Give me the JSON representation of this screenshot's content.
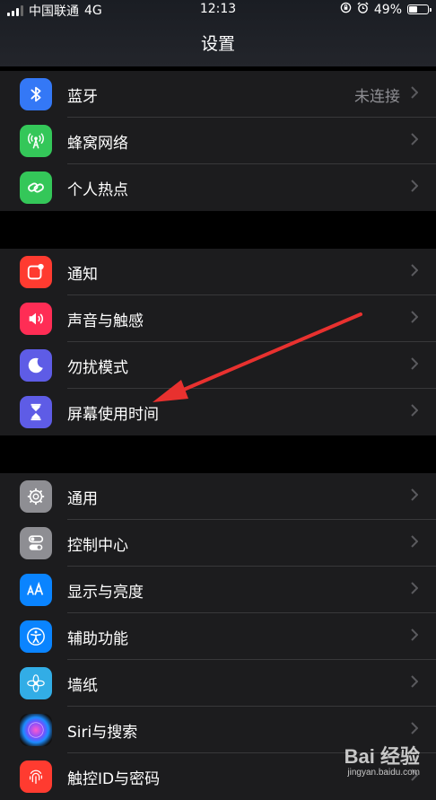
{
  "status_bar": {
    "carrier": "中国联通",
    "network": "4G",
    "time": "12:13",
    "battery": "49%",
    "battery_level": 0.49
  },
  "header": {
    "title": "设置"
  },
  "groups": [
    {
      "items": [
        {
          "label": "蓝牙",
          "value": "未连接",
          "icon": "bluetooth-icon",
          "color": "#3478f6"
        },
        {
          "label": "蜂窝网络",
          "icon": "cellular-icon",
          "color": "#34c759"
        },
        {
          "label": "个人热点",
          "icon": "hotspot-icon",
          "color": "#34c759"
        }
      ]
    },
    {
      "items": [
        {
          "label": "通知",
          "icon": "notifications-icon",
          "color": "#ff3b30"
        },
        {
          "label": "声音与触感",
          "icon": "sound-icon",
          "color": "#ff2d55"
        },
        {
          "label": "勿扰模式",
          "icon": "moon-icon",
          "color": "#5e5ce6"
        },
        {
          "label": "屏幕使用时间",
          "icon": "hourglass-icon",
          "color": "#5e5ce6"
        }
      ]
    },
    {
      "items": [
        {
          "label": "通用",
          "icon": "gear-icon",
          "color": "#8e8e93"
        },
        {
          "label": "控制中心",
          "icon": "toggles-icon",
          "color": "#8e8e93"
        },
        {
          "label": "显示与亮度",
          "icon": "display-aa-icon",
          "color": "#0a84ff"
        },
        {
          "label": "辅助功能",
          "icon": "accessibility-icon",
          "color": "#0a84ff"
        },
        {
          "label": "墙纸",
          "icon": "wallpaper-flower-icon",
          "color": "#32ade6"
        },
        {
          "label": "Siri与搜索",
          "icon": "siri-icon",
          "color": "#1c1c1e"
        },
        {
          "label": "触控ID与密码",
          "icon": "fingerprint-icon",
          "color": "#ff3b30"
        }
      ]
    }
  ],
  "watermark": {
    "main": "Bai 经验",
    "sub": "jingyan.baidu.com"
  }
}
